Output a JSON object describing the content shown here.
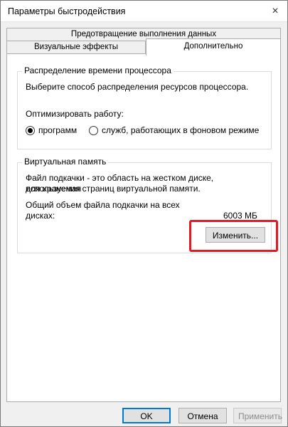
{
  "window": {
    "title": "Параметры быстродействия",
    "close_icon": "×"
  },
  "tabs": {
    "row1": "Предотвращение выполнения данных",
    "visual": "Визуальные эффекты",
    "advanced": "Дополнительно",
    "active": "advanced"
  },
  "cpu_group": {
    "legend": "Распределение времени процессора",
    "description": "Выберите способ распределения ресурсов процессора.",
    "optimize_label": "Оптимизировать работу:",
    "options": [
      {
        "label": "программ",
        "selected": true
      },
      {
        "label": "служб, работающих в фоновом режиме",
        "selected": false
      }
    ]
  },
  "vm_group": {
    "legend": "Виртуальная память",
    "description_line1": "Файл подкачки - это область на жестком диске, используемая",
    "description_line2": "для хранения страниц виртуальной памяти.",
    "total_label_line1": "Общий объем файла подкачки на всех",
    "total_label_line2": "дисках:",
    "total_value": "6003 МБ",
    "change_button": "Изменить..."
  },
  "footer": {
    "ok": "OK",
    "cancel": "Отмена",
    "apply": "Применить"
  },
  "colors": {
    "highlight": "#e01b24",
    "focus": "#0078d7"
  }
}
